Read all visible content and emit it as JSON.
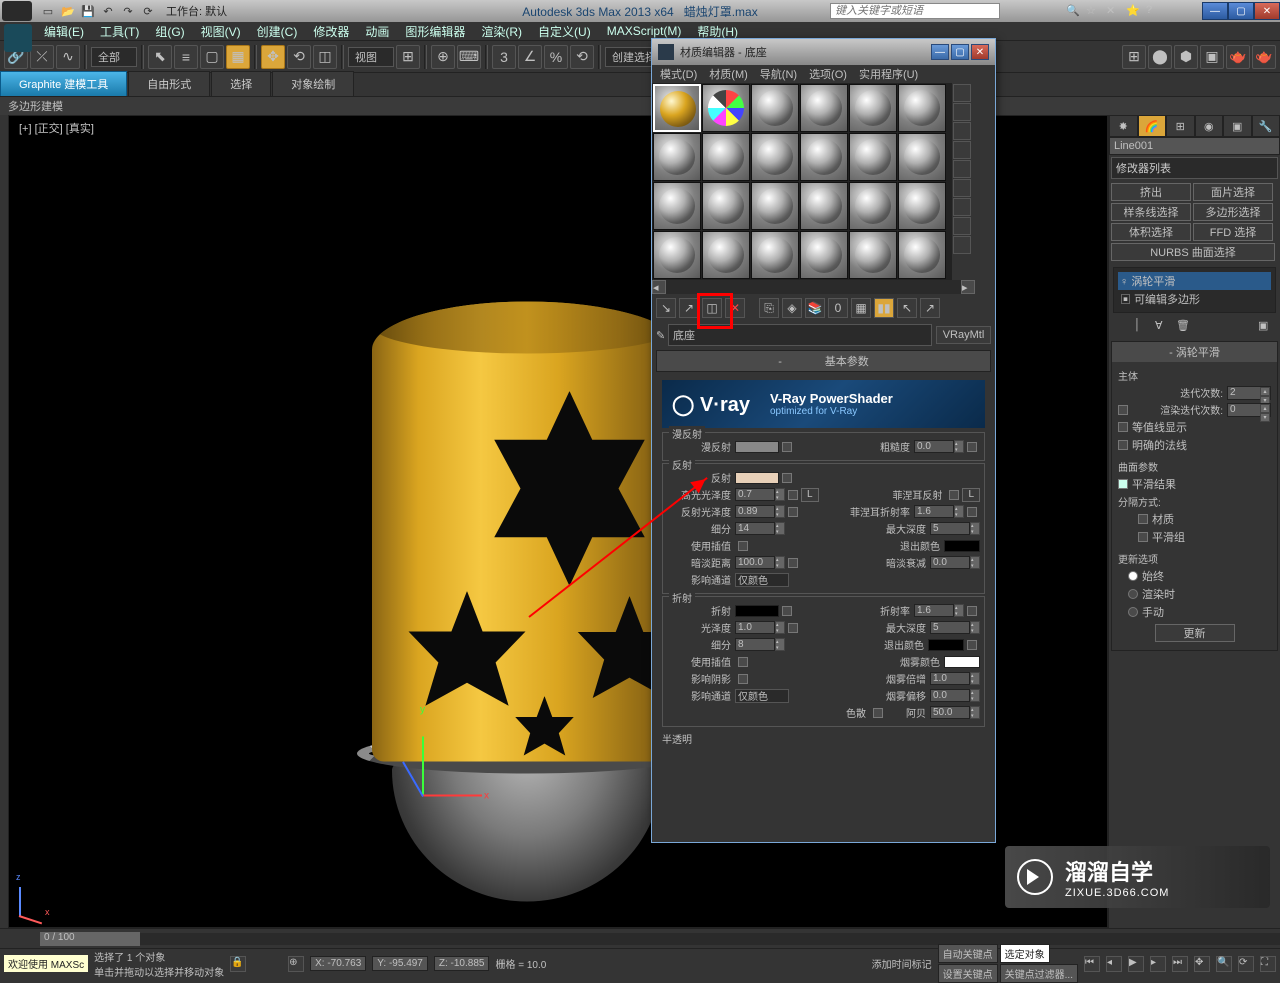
{
  "app": {
    "title": "Autodesk 3ds Max  2013 x64",
    "doc": "蜡烛灯罩.max",
    "workspace_label": "工作台: 默认",
    "search_placeholder": "键入关键字或短语"
  },
  "menus": [
    "编辑(E)",
    "工具(T)",
    "组(G)",
    "视图(V)",
    "创建(C)",
    "修改器",
    "动画",
    "图形编辑器",
    "渲染(R)",
    "自定义(U)",
    "MAXScript(M)",
    "帮助(H)"
  ],
  "toolbar": {
    "scope": "全部",
    "view_combo": "视图",
    "selection_set": "创建选择集"
  },
  "ribbon": {
    "tabs": [
      "Graphite 建模工具",
      "自由形式",
      "选择",
      "对象绘制"
    ],
    "sub": "多边形建模"
  },
  "viewport_label": "[+] [正交] [真实]",
  "cmd_panel": {
    "obj_name": "Line001",
    "modifier_list": "修改器列表",
    "btns": [
      "挤出",
      "面片选择",
      "样条线选择",
      "多边形选择",
      "体积选择",
      "FFD 选择",
      "NURBS 曲面选择"
    ],
    "stack": [
      "涡轮平滑",
      "可编辑多边形"
    ],
    "rollout1": {
      "title": "涡轮平滑",
      "group1": "主体",
      "iterations": "迭代次数:",
      "iterations_val": "2",
      "render_iter": "渲染迭代次数:",
      "render_iter_val": "0",
      "isoline": "等值线显示",
      "explicit": "明确的法线",
      "group2": "曲面参数",
      "smooth_result": "平滑结果",
      "sep_by": "分隔方式:",
      "by_mat": "材质",
      "by_smg": "平滑组",
      "group3": "更新选项",
      "always": "始终",
      "render": "渲染时",
      "manual": "手动",
      "update_btn": "更新"
    }
  },
  "mat_editor": {
    "title": "材质编辑器 - 底座",
    "menus": [
      "模式(D)",
      "材质(M)",
      "导航(N)",
      "选项(O)",
      "实用程序(U)"
    ],
    "mat_name": "底座",
    "mat_type": "VRayMtl",
    "rollout_basic": "基本参数",
    "vray_text": "V-Ray PowerShader",
    "vray_sub": "optimized for V-Ray",
    "diffuse": {
      "group": "漫反射",
      "label": "漫反射",
      "rough_lbl": "粗糙度",
      "rough_val": "0.0"
    },
    "reflect": {
      "group": "反射",
      "label": "反射",
      "hilight_gloss": "高光光泽度",
      "hilight_val": "0.7",
      "lock_btn": "L",
      "fresnel": "菲涅耳反射",
      "fresnel_l": "L",
      "reflect_gloss": "反射光泽度",
      "reflect_val": "0.89",
      "fresnel_ior": "菲涅耳折射率",
      "fresnel_ior_val": "1.6",
      "subdivs": "细分",
      "subdivs_val": "14",
      "max_depth": "最大深度",
      "max_depth_val": "5",
      "interp": "使用插值",
      "exit_color": "退出颜色",
      "dim_dist": "暗淡距离",
      "dim_dist_val": "100.0",
      "dim_falloff": "暗淡衰减",
      "dim_falloff_val": "0.0",
      "affect": "影响通道",
      "affect_val": "仅颜色"
    },
    "refract": {
      "group": "折射",
      "label": "折射",
      "ior": "折射率",
      "ior_val": "1.6",
      "gloss": "光泽度",
      "gloss_val": "1.0",
      "max_depth": "最大深度",
      "max_depth_val": "5",
      "subdivs": "细分",
      "subdivs_val": "8",
      "exit_color": "退出颜色",
      "interp": "使用插值",
      "fog_color": "烟雾颜色",
      "shadows": "影响阴影",
      "fog_mult": "烟雾倍增",
      "fog_mult_val": "1.0",
      "affect": "影响通道",
      "affect_val": "仅颜色",
      "fog_bias": "烟雾偏移",
      "fog_bias_val": "0.0",
      "dispersion": "色散",
      "abbe": "阿贝",
      "abbe_val": "50.0"
    },
    "translucency": "半透明"
  },
  "status": {
    "timeline_pos": "0 / 100",
    "selection": "选择了 1 个对象",
    "hint": "单击并拖动以选择并移动对象",
    "x": "X: -70.763",
    "y": "Y: -95.497",
    "z": "Z: -10.885",
    "grid": "栅格 = 10.0",
    "add_time_tag": "添加时间标记",
    "auto_key": "自动关键点",
    "selected": "选定对象",
    "set_key": "设置关键点",
    "key_filters": "关键点过滤器..."
  },
  "welcome": "欢迎使用  MAXSc",
  "watermark": {
    "big": "溜溜自学",
    "small": "ZIXUE.3D66.COM"
  }
}
